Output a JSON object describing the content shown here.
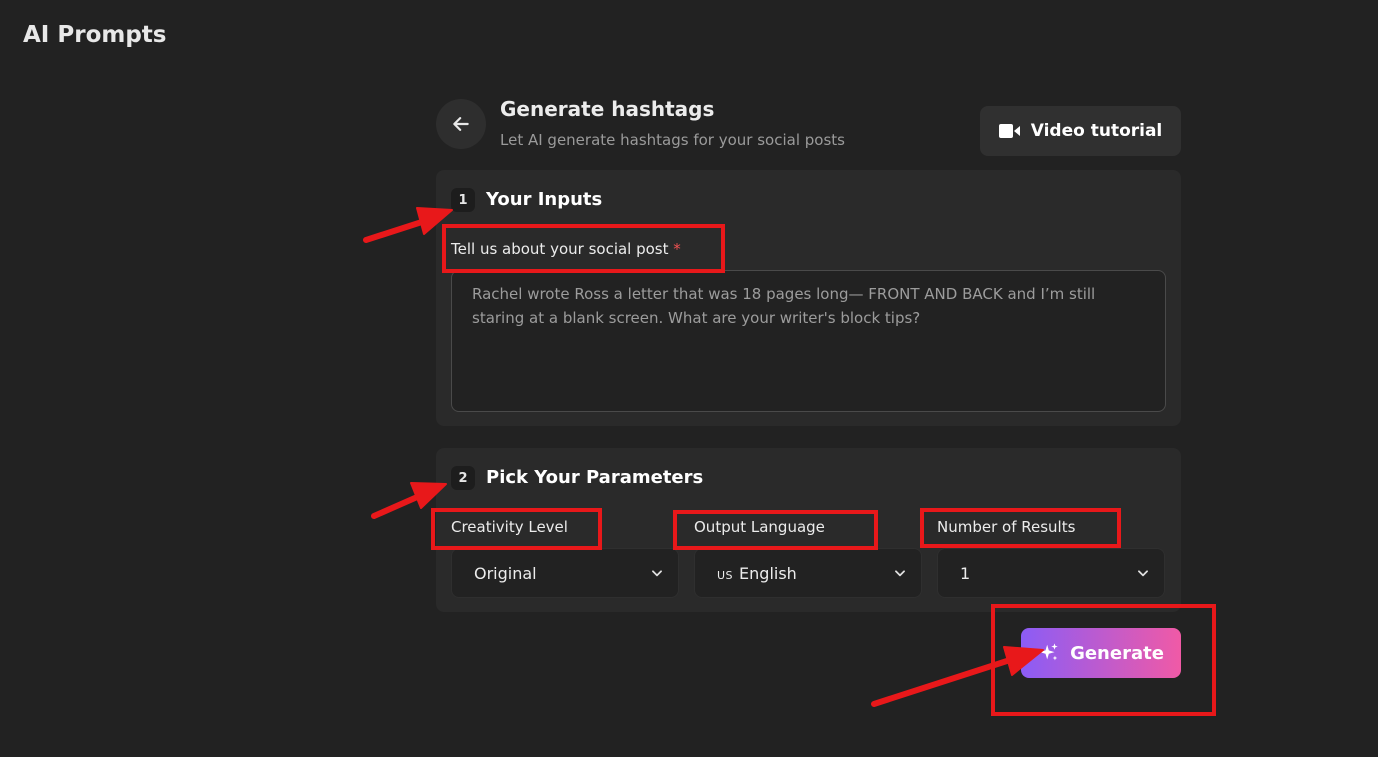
{
  "app": {
    "title": "AI Prompts"
  },
  "header": {
    "title": "Generate hashtags",
    "subtitle": "Let AI generate hashtags for your social posts",
    "video_button_label": "Video tutorial"
  },
  "inputs_section": {
    "step": "1",
    "title": "Your Inputs",
    "post_label": "Tell us about your social post",
    "required_mark": "*",
    "post_placeholder": "Rachel wrote Ross a letter that was 18 pages long— FRONT AND BACK and I’m still staring at a blank screen. What are your writer's block tips?"
  },
  "params_section": {
    "step": "2",
    "title": "Pick Your Parameters",
    "creativity": {
      "label": "Creativity Level",
      "value": "Original"
    },
    "language": {
      "label": "Output Language",
      "flag": "US",
      "value": "English"
    },
    "results": {
      "label": "Number of Results",
      "value": "1"
    }
  },
  "actions": {
    "generate_label": "Generate"
  },
  "colors": {
    "background": "#222222",
    "panel": "#2a2a2a",
    "gradient_start": "#8b5cf6",
    "gradient_end": "#f05aa6",
    "annotation": "#e8181a",
    "required": "#f05252"
  },
  "icons": {
    "back": "arrow-left-icon",
    "video": "video-camera-icon",
    "chevron": "chevron-down-icon",
    "sparkle": "sparkles-icon"
  }
}
